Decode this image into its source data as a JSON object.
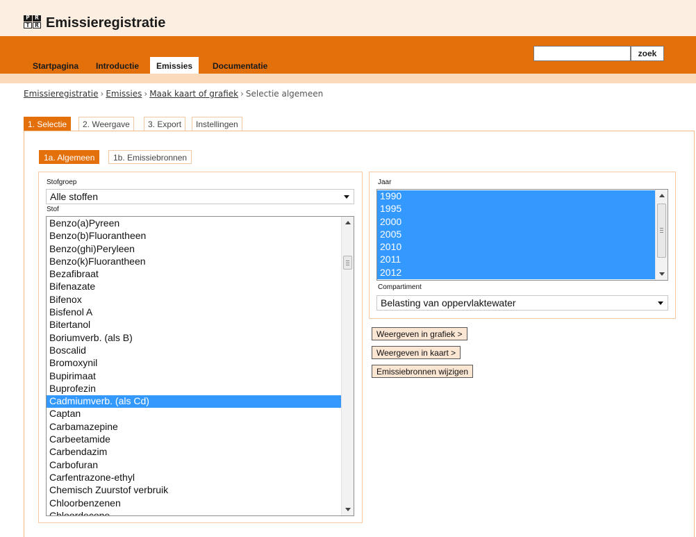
{
  "header": {
    "logo_letters": [
      "P",
      "R",
      "T",
      "R"
    ],
    "site_title": "Emissieregistratie"
  },
  "nav": {
    "items": [
      {
        "label": "Startpagina",
        "active": false
      },
      {
        "label": "Introductie",
        "active": false
      },
      {
        "label": "Emissies",
        "active": true
      },
      {
        "label": "Documentatie",
        "active": false
      }
    ],
    "search": {
      "value": "",
      "button_label": "zoek"
    }
  },
  "breadcrumb": {
    "links": [
      "Emissieregistratie",
      "Emissies",
      "Maak kaart of grafiek"
    ],
    "separator": "›",
    "current": "Selectie algemeen"
  },
  "tabs": [
    {
      "label": "1. Selectie",
      "active": true
    },
    {
      "label": "2. Weergave",
      "active": false
    },
    {
      "label": "3. Export",
      "active": false
    },
    {
      "label": "Instellingen",
      "active": false
    }
  ],
  "subtabs": [
    {
      "label": "1a. Algemeen",
      "active": true
    },
    {
      "label": "1b. Emissiebronnen",
      "active": false
    }
  ],
  "left": {
    "stofgroep_label": "Stofgroep",
    "stofgroep_value": "Alle stoffen",
    "stof_label": "Stof",
    "stof_items": [
      "Benzo(a)Pyreen",
      "Benzo(b)Fluorantheen",
      "Benzo(ghi)Peryleen",
      "Benzo(k)Fluorantheen",
      "Bezafibraat",
      "Bifenazate",
      "Bifenox",
      "Bisfenol A",
      "Bitertanol",
      "Boriumverb. (als B)",
      "Boscalid",
      "Bromoxynil",
      "Bupirimaat",
      "Buprofezin",
      "Cadmiumverb. (als Cd)",
      "Captan",
      "Carbamazepine",
      "Carbeetamide",
      "Carbendazim",
      "Carbofuran",
      "Carfentrazone-ethyl",
      "Chemisch Zuurstof verbruik",
      "Chloorbenzenen",
      "Chloordecone"
    ],
    "stof_selected": "Cadmiumverb. (als Cd)"
  },
  "right": {
    "jaar_label": "Jaar",
    "jaar_items": [
      "1990",
      "1995",
      "2000",
      "2005",
      "2010",
      "2011",
      "2012"
    ],
    "jaar_selected_all": true,
    "compartiment_label": "Compartiment",
    "compartiment_value": "Belasting van oppervlaktewater"
  },
  "buttons": {
    "grafiek": "Weergeven in grafiek >",
    "kaart": "Weergeven in kaart >",
    "bronnen": "Emissiebronnen wijzigen"
  },
  "colors": {
    "accent": "#e3700a",
    "header_bg": "#fdeee2",
    "selection": "#3399ff"
  }
}
